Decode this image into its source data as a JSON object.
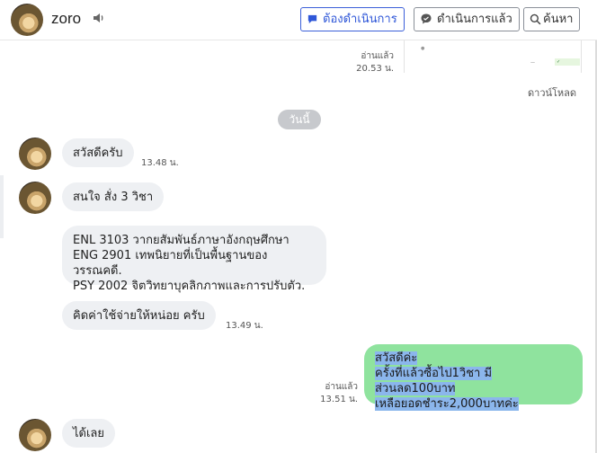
{
  "header": {
    "name": "zoro",
    "speaker_icon": "speaker-icon",
    "buttons": {
      "todo": "ต้องดำเนินการ",
      "done": "ดำเนินการแล้ว",
      "search": "ค้นหา"
    }
  },
  "colors": {
    "accent": "#3b5fd9",
    "bubble_in": "#eef0f3",
    "bubble_out": "#8fe39e",
    "highlight": "#8bb6ec"
  },
  "top": {
    "read_label": "อ่านแล้ว",
    "read_time": "20.53 น.",
    "download_label": "ดาวน์โหลด"
  },
  "date_separator": "วันนี้",
  "messages": [
    {
      "text": "สวัสดีครับ",
      "time": "13.48 น."
    },
    {
      "text": "สนใจ สั่ง 3 วิชา"
    },
    {
      "lines": [
        "ENL 3103 วากยสัมพันธ์ภาษาอังกฤษศึกษา",
        "ENG 2901 เทพนิยายที่เป็นพื้นฐานของวรรณคดี.",
        "PSY 2002 จิตวิทยาบุคลิกภาพและการปรับตัว."
      ]
    },
    {
      "text": "คิดค่าใช้จ่ายให้หน่อย ครับ",
      "time": "13.49 น."
    },
    {
      "lines": [
        "สวัสดีค่ะ",
        "ครั้งที่แล้วซื้อไป1วิชา มีส่วนลด100บาท",
        "เหลือยอดชำระ2,000บาทค่ะ"
      ],
      "read_label": "อ่านแล้ว",
      "time": "13.51 น."
    },
    {
      "text": "ได้เลย"
    }
  ]
}
